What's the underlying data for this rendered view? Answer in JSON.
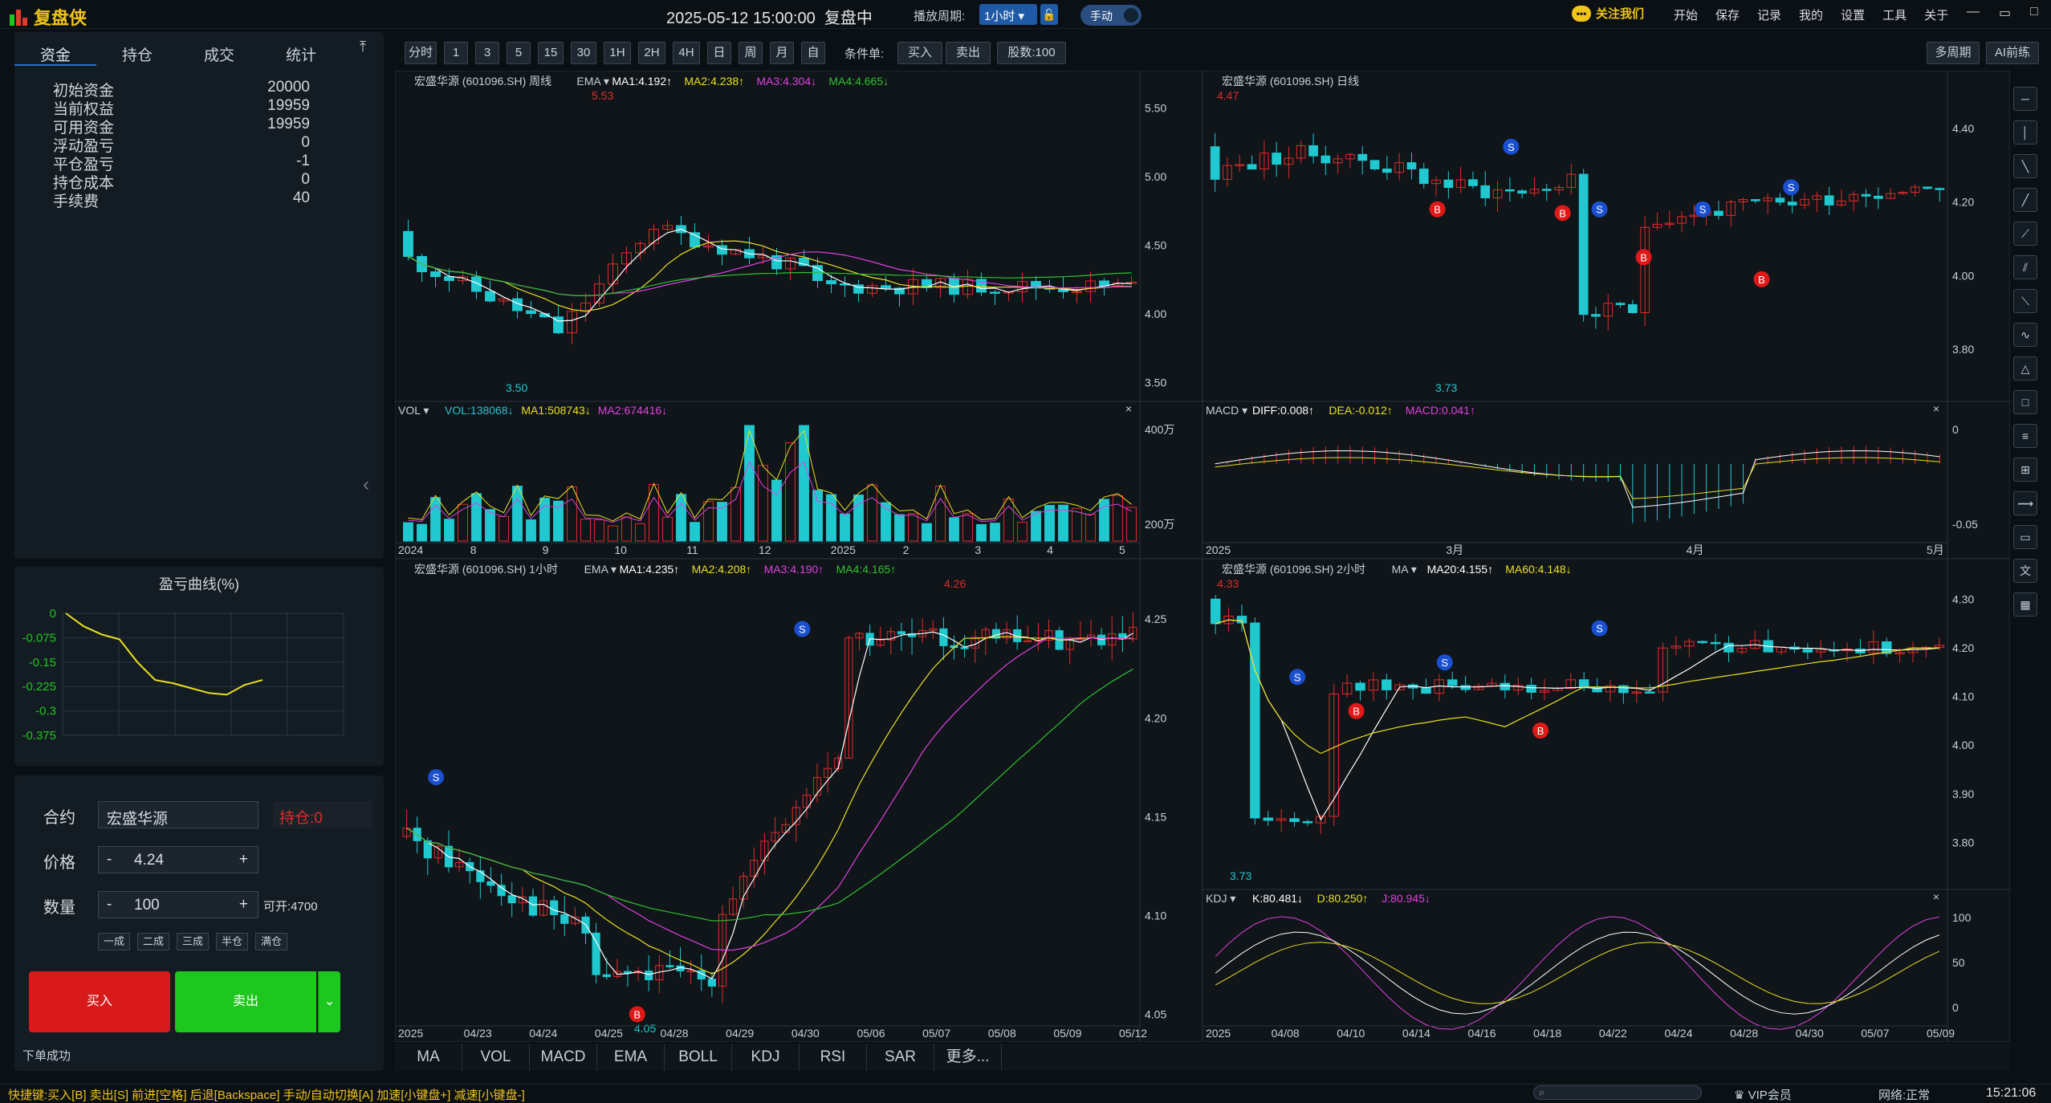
{
  "app": {
    "name": "复盘侠"
  },
  "header": {
    "datetime": "2025-05-12 15:00:00",
    "status": "复盘中",
    "speed_label": "播放周期:",
    "period": "1小时",
    "lock_icon": "unlock-icon",
    "mode": "手动",
    "follow": "关注我们",
    "menu": [
      "开始",
      "保存",
      "记录",
      "我的",
      "设置",
      "工具",
      "关于"
    ],
    "window_controls": [
      "—",
      "▭",
      "□",
      "✕"
    ]
  },
  "left_panel": {
    "tabs": [
      "资金",
      "持仓",
      "成交",
      "统计"
    ],
    "active_tab": "资金",
    "stats": [
      {
        "label": "初始资金",
        "value": "20000"
      },
      {
        "label": "当前权益",
        "value": "19959"
      },
      {
        "label": "可用资金",
        "value": "19959"
      },
      {
        "label": "浮动盈亏",
        "value": "0"
      },
      {
        "label": "平仓盈亏",
        "value": "-1"
      },
      {
        "label": "持仓成本",
        "value": "0"
      },
      {
        "label": "手续费",
        "value": "40"
      }
    ]
  },
  "pnl_curve": {
    "title": "盈亏曲线(%)",
    "yticks": [
      "0",
      "-0.075",
      "-0.15",
      "-0.225",
      "-0.3",
      "-0.375"
    ],
    "points": [
      0,
      -0.04,
      -0.065,
      -0.08,
      -0.15,
      -0.205,
      -0.215,
      -0.23,
      -0.245,
      -0.25,
      -0.22,
      -0.205
    ],
    "color": "#e8e020"
  },
  "order": {
    "contract_label": "合约",
    "contract": "宏盛华源",
    "position": "持仓:0",
    "price_label": "价格",
    "price": "4.24",
    "qty_label": "数量",
    "qty": "100",
    "avail": "可开:4700",
    "lots": [
      "一成",
      "二成",
      "三成",
      "半仓",
      "满仓"
    ],
    "buy": "买入",
    "sell": "卖出",
    "status": "下单成功"
  },
  "toolbar": {
    "periods": [
      "分时",
      "1",
      "3",
      "5",
      "15",
      "30",
      "1H",
      "2H",
      "4H",
      "日",
      "周",
      "月",
      "自"
    ],
    "cond_label": "条件单:",
    "cond_buy": "买入",
    "cond_sell": "卖出",
    "shares": "股数:100",
    "multi_period": "多周期",
    "ai_practice": "AI前练"
  },
  "charts": {
    "weekly": {
      "title": "宏盛华源 (601096.SH)",
      "period": "周线",
      "indicator": "EMA",
      "ma": [
        {
          "t": "MA1:4.192↑",
          "c": "#ffffff"
        },
        {
          "t": "MA2:4.238↑",
          "c": "#e8e020"
        },
        {
          "t": "MA3:4.304↓",
          "c": "#e040e0"
        },
        {
          "t": "MA4:4.665↓",
          "c": "#30c030"
        }
      ],
      "yticks": [
        "5.50",
        "5.00",
        "4.50",
        "4.00",
        "3.50"
      ],
      "high_label": "5.53",
      "low_label": "3.50",
      "sub": {
        "name": "VOL",
        "vals": [
          {
            "t": "VOL:138068↓",
            "c": "#30c0d0"
          },
          {
            "t": "MA1:508743↓",
            "c": "#e8e020"
          },
          {
            "t": "MA2:674416↓",
            "c": "#e040e0"
          }
        ],
        "yticks": [
          "400万",
          "200万"
        ]
      },
      "xticks": [
        "2024",
        "8",
        "9",
        "10",
        "11",
        "12",
        "2025",
        "2",
        "3",
        "4",
        "5"
      ]
    },
    "daily": {
      "title": "宏盛华源 (601096.SH)",
      "period": "日线",
      "yticks": [
        "4.40",
        "4.20",
        "4.00",
        "3.80"
      ],
      "high_label": "4.47",
      "low_label": "3.73",
      "sub": {
        "name": "MACD",
        "vals": [
          {
            "t": "DIFF:0.008↑",
            "c": "#ffffff"
          },
          {
            "t": "DEA:-0.012↑",
            "c": "#e8e020"
          },
          {
            "t": "MACD:0.041↑",
            "c": "#e040e0"
          }
        ],
        "yticks": [
          "0",
          "-0.05"
        ]
      },
      "xticks": [
        "2025",
        "3月",
        "4月",
        "5月"
      ]
    },
    "hour1": {
      "title": "宏盛华源 (601096.SH)",
      "period": "1小时",
      "indicator": "EMA",
      "ma": [
        {
          "t": "MA1:4.235↑",
          "c": "#ffffff"
        },
        {
          "t": "MA2:4.208↑",
          "c": "#e8e020"
        },
        {
          "t": "MA3:4.190↑",
          "c": "#e040e0"
        },
        {
          "t": "MA4:4.165↑",
          "c": "#30c030"
        }
      ],
      "yticks": [
        "4.25",
        "4.20",
        "4.15",
        "4.10",
        "4.05"
      ],
      "high_label": "4.26",
      "low_label": "4.05",
      "xticks": [
        "2025",
        "04/23",
        "04/24",
        "04/25",
        "04/28",
        "04/29",
        "04/30",
        "05/06",
        "05/07",
        "05/08",
        "05/09",
        "05/12"
      ]
    },
    "hour2": {
      "title": "宏盛华源 (601096.SH)",
      "period": "2小时",
      "indicator": "MA",
      "ma": [
        {
          "t": "MA20:4.155↑",
          "c": "#ffffff"
        },
        {
          "t": "MA60:4.148↓",
          "c": "#e8e020"
        }
      ],
      "yticks": [
        "4.30",
        "4.20",
        "4.10",
        "4.00",
        "3.90",
        "3.80"
      ],
      "high_label": "4.33",
      "low_label": "3.73",
      "sub": {
        "name": "KDJ",
        "vals": [
          {
            "t": "K:80.481↓",
            "c": "#ffffff"
          },
          {
            "t": "D:80.250↑",
            "c": "#e8e020"
          },
          {
            "t": "J:80.945↓",
            "c": "#e040e0"
          }
        ],
        "yticks": [
          "100",
          "50",
          "0"
        ]
      },
      "xticks": [
        "2025",
        "04/08",
        "04/10",
        "04/14",
        "04/16",
        "04/18",
        "04/22",
        "04/24",
        "04/28",
        "04/30",
        "05/07",
        "05/09"
      ]
    }
  },
  "indicator_tabs": [
    "MA",
    "VOL",
    "MACD",
    "EMA",
    "BOLL",
    "KDJ",
    "RSI",
    "SAR",
    "更多..."
  ],
  "right_tools": [
    "horizontal-line-icon",
    "vertical-line-icon",
    "ray-icon",
    "segment-icon",
    "extend-line-icon",
    "parallel-icon",
    "price-line-icon",
    "wave-icon",
    "triangle-icon",
    "rectangle-icon",
    "fib-icon",
    "gann-icon",
    "measure-icon",
    "ruler-icon",
    "text-icon",
    "delete-icon"
  ],
  "status_bar": {
    "hint": "快捷键:买入[B] 卖出[S] 前进[空格] 后退[Backspace] 手动/自动切换[A] 加速[小键盘+] 减速[小键盘-]",
    "vip": "VIP会员",
    "net": "网络:正常",
    "clock": "15:21:06"
  },
  "colors": {
    "up": "#e02b2b",
    "down": "#20c8d0",
    "accent": "#1f5aa6",
    "buy": "#d91a1a",
    "sell": "#1ec71e",
    "ma_white": "#ffffff",
    "ma_yellow": "#e8e020",
    "ma_purple": "#e040e0",
    "ma_green": "#30c030"
  }
}
